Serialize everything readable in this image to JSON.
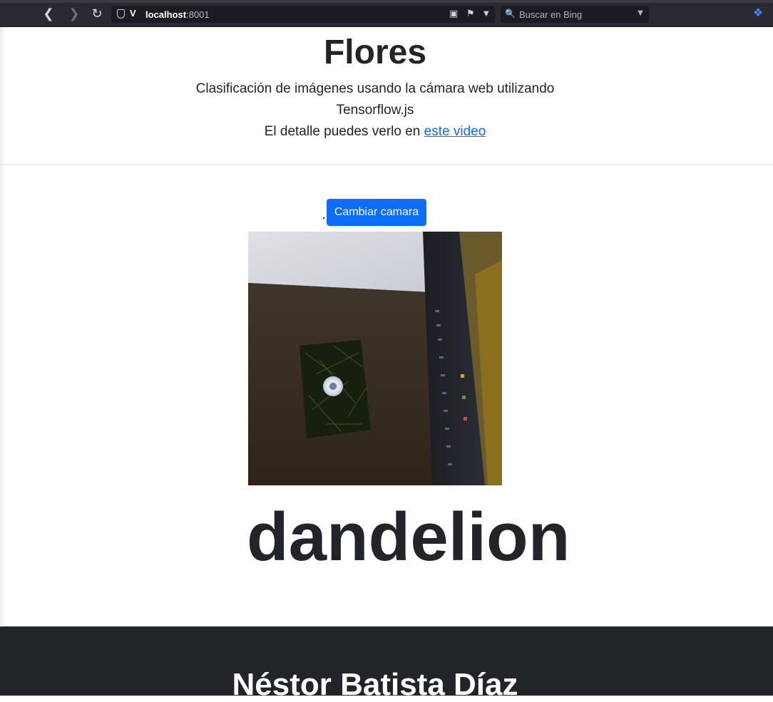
{
  "browser": {
    "url_host": "localhost",
    "url_port": ":8001",
    "search_placeholder": "Buscar en Bing",
    "icons": [
      "back-icon",
      "forward-icon",
      "reload-icon",
      "shield-icon",
      "vivaldi-icon",
      "camera-icon",
      "bookmark-icon",
      "dropdown-icon",
      "search-icon",
      "extension-icon"
    ]
  },
  "header": {
    "title": "Flores",
    "subtitle_line1": "Clasificación de imágenes usando la cámara web utilizando",
    "subtitle_line2": "Tensorflow.js",
    "detail_text": "El detalle puedes verlo en ",
    "detail_link": "este video"
  },
  "main": {
    "switch_camera_label": "Cambiar camara",
    "prediction": "dandelion"
  },
  "footer": {
    "author": "Néstor Batista Díaz"
  },
  "colors": {
    "primary": "#0d6efd",
    "text": "#212529",
    "footer_bg": "#212529",
    "browser_bg": "#2b2a33"
  }
}
